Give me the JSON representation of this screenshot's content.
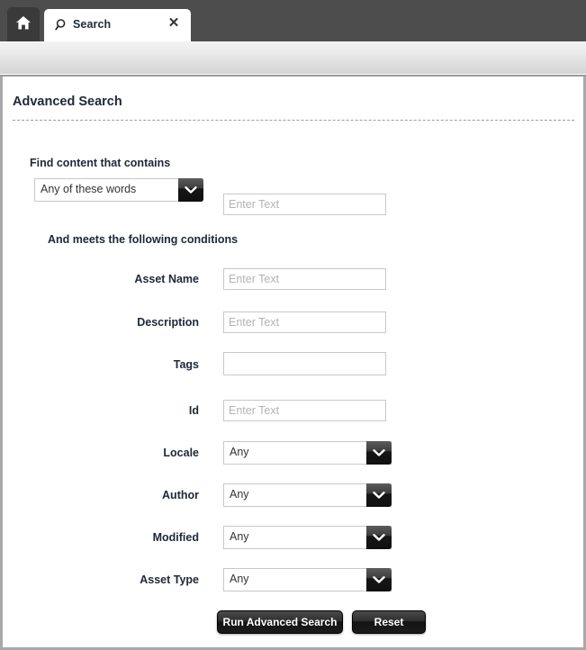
{
  "window": {
    "tabs": [
      {
        "name": "home",
        "icon": "home-icon",
        "label": ""
      },
      {
        "name": "search",
        "icon": "search-icon",
        "label": "Search",
        "close_label": "✕"
      }
    ]
  },
  "page": {
    "title": "Advanced Search"
  },
  "sections": {
    "find": {
      "heading": "Find content that contains",
      "match_select": {
        "value": "Any of these words"
      },
      "keyword_input": {
        "value": "",
        "placeholder": "Enter Text"
      }
    },
    "conditions": {
      "heading": "And meets the following conditions",
      "fields": [
        {
          "name": "asset-name",
          "label": "Asset Name",
          "type": "text",
          "value": "",
          "placeholder": "Enter Text"
        },
        {
          "name": "description",
          "label": "Description",
          "type": "text",
          "value": "",
          "placeholder": "Enter Text"
        },
        {
          "name": "tags",
          "label": "Tags",
          "type": "text",
          "value": "",
          "placeholder": ""
        },
        {
          "name": "id",
          "label": "Id",
          "type": "text",
          "value": "",
          "placeholder": "Enter Text"
        },
        {
          "name": "locale",
          "label": "Locale",
          "type": "select",
          "value": "Any"
        },
        {
          "name": "author",
          "label": "Author",
          "type": "select",
          "value": "Any"
        },
        {
          "name": "modified",
          "label": "Modified",
          "type": "select",
          "value": "Any"
        },
        {
          "name": "asset-type",
          "label": "Asset Type",
          "type": "select",
          "value": "Any"
        }
      ]
    }
  },
  "actions": {
    "run_search_label": "Run Advanced Search",
    "reset_label": "Reset"
  },
  "colors": {
    "header_bar": "#4d4d4d",
    "home_tab": "#3a3a3a",
    "active_tab": "#ffffff",
    "panel_border": "#a8a8a8",
    "text_dark": "#20293a",
    "placeholder": "#b3b3b3",
    "button_dark": "#1b1b1b"
  }
}
